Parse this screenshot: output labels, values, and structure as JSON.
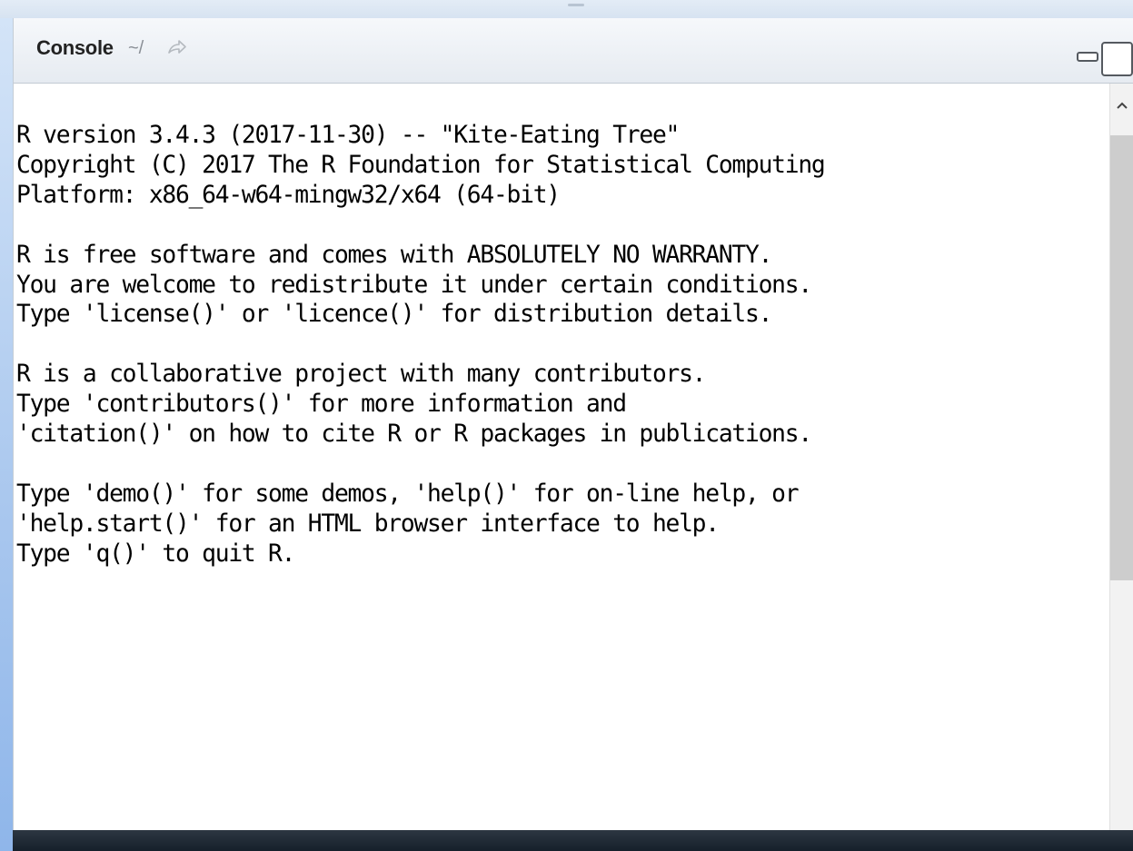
{
  "pane": {
    "title": "Console",
    "path": "~/",
    "icons": {
      "goto_directory": "go-to-directory-icon",
      "minimize": "minimize-icon",
      "maximize": "maximize-icon",
      "scroll_up": "scroll-up-arrow-icon"
    }
  },
  "console": {
    "lines": [
      "R version 3.4.3 (2017-11-30) -- \"Kite-Eating Tree\"",
      "Copyright (C) 2017 The R Foundation for Statistical Computing",
      "Platform: x86_64-w64-mingw32/x64 (64-bit)",
      "",
      "R is free software and comes with ABSOLUTELY NO WARRANTY.",
      "You are welcome to redistribute it under certain conditions.",
      "Type 'license()' or 'licence()' for distribution details.",
      "",
      "R is a collaborative project with many contributors.",
      "Type 'contributors()' for more information and",
      "'citation()' on how to cite R or R packages in publications.",
      "",
      "Type 'demo()' for some demos, 'help()' for on-line help, or",
      "'help.start()' for an HTML browser interface to help.",
      "Type 'q()' to quit R."
    ]
  },
  "colors": {
    "background_blue": "#b9d3f1",
    "header_gradient_top": "#f6f8fb",
    "header_gradient_bottom": "#e6ebf1",
    "console_background": "#ffffff",
    "text": "#000000",
    "path_text": "#8a8f96",
    "scroll_thumb": "#cdcdcd",
    "bottom_bar": "#1c2631"
  }
}
